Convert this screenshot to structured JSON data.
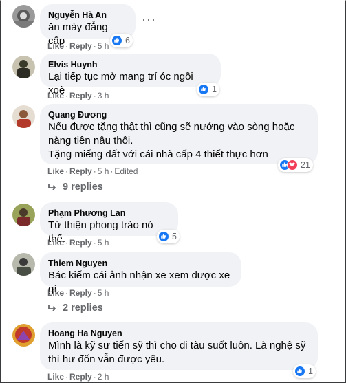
{
  "comments": [
    {
      "author": "Nguyễn Hà An",
      "text": "ăn mày đẳng cấp",
      "actions": {
        "like": "Like",
        "reply": "Reply",
        "time": "5 h"
      },
      "reactions": {
        "count": "6",
        "types": [
          "like"
        ]
      },
      "more": "···",
      "avatar_color": "#8c8c8c"
    },
    {
      "author": "Elvis Huynh",
      "text": "Lại tiếp tục mở mang trí óc ngồi xoè",
      "actions": {
        "like": "Like",
        "reply": "Reply",
        "time": "3 h"
      },
      "reactions": {
        "count": "1",
        "types": [
          "like"
        ]
      },
      "avatar_color": "#4a4a3a"
    },
    {
      "author": "Quang Đương",
      "text": "Nếu được tặng thật thì cũng sẽ nướng vào sòng hoặc\nnàng tiên nâu thôi.\nTặng miếng đất với cái nhà cấp 4 thiết thực hơn",
      "actions": {
        "like": "Like",
        "reply": "Reply",
        "time": "5 h",
        "edited": "Edited"
      },
      "reactions": {
        "count": "21",
        "types": [
          "like",
          "love"
        ]
      },
      "replies": "9 replies",
      "avatar_color": "#c9b8a8"
    },
    {
      "author": "Phạm Phương Lan",
      "text": "Từ thiện phong trào nó thế.",
      "actions": {
        "like": "Like",
        "reply": "Reply",
        "time": "5 h"
      },
      "reactions": {
        "count": "5",
        "types": [
          "like"
        ]
      },
      "avatar_color": "#6b7a3a"
    },
    {
      "author": "Thiem Nguyen",
      "text": "Bác kiếm cái ảnh nhận xe xem được xe gì",
      "actions": {
        "like": "Like",
        "reply": "Reply",
        "time": "5 h"
      },
      "replies": "2 replies",
      "avatar_color": "#5a5f55"
    },
    {
      "author": "Hoang Ha Nguyen",
      "text": "Mình là kỹ sư tiến sỹ thì cho đi tàu suốt luôn. Là nghệ sỹ\nthì hư đốn vẫn được yêu.",
      "actions": {
        "like": "Like",
        "reply": "Reply",
        "time": "2 h"
      },
      "reactions": {
        "count": "1",
        "types": [
          "like"
        ]
      },
      "avatar_color": "#c0392b"
    }
  ],
  "colors": {
    "bubble": "#f0f2f5",
    "meta": "#65676b",
    "like": "#1877f2",
    "love": "#f33e58"
  }
}
